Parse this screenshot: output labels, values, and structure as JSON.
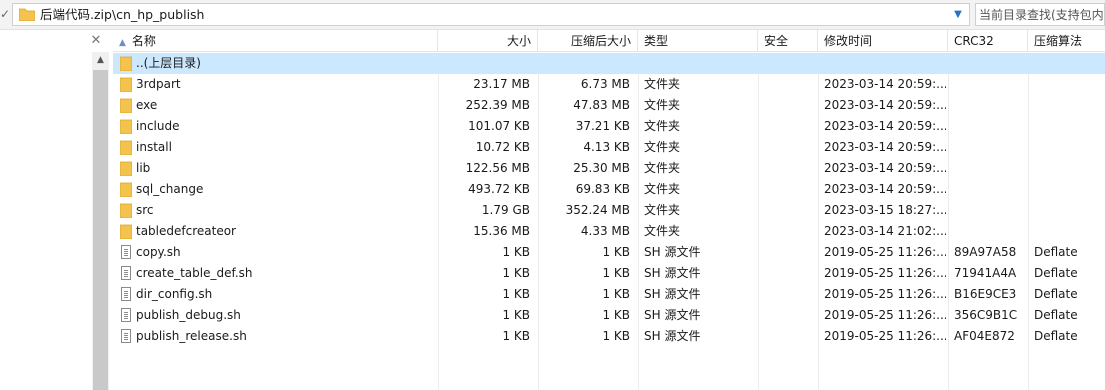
{
  "toolbar": {
    "path": "后端代码.zip\\cn_hp_publish",
    "search_placeholder": "当前目录查找(支持包内查找)",
    "dropdown_icon": "chevron-down-icon",
    "left_glyph": "✓"
  },
  "left_panel": {
    "close_glyph": "✕",
    "scroll_up_glyph": "▲"
  },
  "columns": {
    "name": "名称",
    "size": "大小",
    "packed": "压缩后大小",
    "type": "类型",
    "security": "安全",
    "modified": "修改时间",
    "crc": "CRC32",
    "method": "压缩算法",
    "sort_glyph": "▲"
  },
  "colors": {
    "selected_row": "#cce8ff",
    "folder": "#f3c34d"
  },
  "rows": [
    {
      "icon": "folder-icon",
      "name": "..(上层目录)",
      "size": "",
      "packed": "",
      "type": "",
      "security": "",
      "modified": "",
      "crc": "",
      "method": "",
      "selected": true
    },
    {
      "icon": "folder-icon",
      "name": "3rdpart",
      "size": "23.17 MB",
      "packed": "6.73 MB",
      "type": "文件夹",
      "security": "",
      "modified": "2023-03-14 20:59:...",
      "crc": "",
      "method": ""
    },
    {
      "icon": "folder-icon",
      "name": "exe",
      "size": "252.39 MB",
      "packed": "47.83 MB",
      "type": "文件夹",
      "security": "",
      "modified": "2023-03-14 20:59:...",
      "crc": "",
      "method": ""
    },
    {
      "icon": "folder-icon",
      "name": "include",
      "size": "101.07 KB",
      "packed": "37.21 KB",
      "type": "文件夹",
      "security": "",
      "modified": "2023-03-14 20:59:...",
      "crc": "",
      "method": ""
    },
    {
      "icon": "folder-icon",
      "name": "install",
      "size": "10.72 KB",
      "packed": "4.13 KB",
      "type": "文件夹",
      "security": "",
      "modified": "2023-03-14 20:59:...",
      "crc": "",
      "method": ""
    },
    {
      "icon": "folder-icon",
      "name": "lib",
      "size": "122.56 MB",
      "packed": "25.30 MB",
      "type": "文件夹",
      "security": "",
      "modified": "2023-03-14 20:59:...",
      "crc": "",
      "method": ""
    },
    {
      "icon": "folder-icon",
      "name": "sql_change",
      "size": "493.72 KB",
      "packed": "69.83 KB",
      "type": "文件夹",
      "security": "",
      "modified": "2023-03-14 20:59:...",
      "crc": "",
      "method": ""
    },
    {
      "icon": "folder-icon",
      "name": "src",
      "size": "1.79 GB",
      "packed": "352.24 MB",
      "type": "文件夹",
      "security": "",
      "modified": "2023-03-15 18:27:...",
      "crc": "",
      "method": ""
    },
    {
      "icon": "folder-icon",
      "name": "tabledefcreateor",
      "size": "15.36 MB",
      "packed": "4.33 MB",
      "type": "文件夹",
      "security": "",
      "modified": "2023-03-14 21:02:...",
      "crc": "",
      "method": ""
    },
    {
      "icon": "file-icon",
      "name": "copy.sh",
      "size": "1 KB",
      "packed": "1 KB",
      "type": "SH 源文件",
      "security": "",
      "modified": "2019-05-25 11:26:...",
      "crc": "89A97A58",
      "method": "Deflate"
    },
    {
      "icon": "file-icon",
      "name": "create_table_def.sh",
      "size": "1 KB",
      "packed": "1 KB",
      "type": "SH 源文件",
      "security": "",
      "modified": "2019-05-25 11:26:...",
      "crc": "71941A4A",
      "method": "Deflate"
    },
    {
      "icon": "file-icon",
      "name": "dir_config.sh",
      "size": "1 KB",
      "packed": "1 KB",
      "type": "SH 源文件",
      "security": "",
      "modified": "2019-05-25 11:26:...",
      "crc": "B16E9CE3",
      "method": "Deflate"
    },
    {
      "icon": "file-icon",
      "name": "publish_debug.sh",
      "size": "1 KB",
      "packed": "1 KB",
      "type": "SH 源文件",
      "security": "",
      "modified": "2019-05-25 11:26:...",
      "crc": "356C9B1C",
      "method": "Deflate"
    },
    {
      "icon": "file-icon",
      "name": "publish_release.sh",
      "size": "1 KB",
      "packed": "1 KB",
      "type": "SH 源文件",
      "security": "",
      "modified": "2019-05-25 11:26:...",
      "crc": "AF04E872",
      "method": "Deflate"
    }
  ]
}
